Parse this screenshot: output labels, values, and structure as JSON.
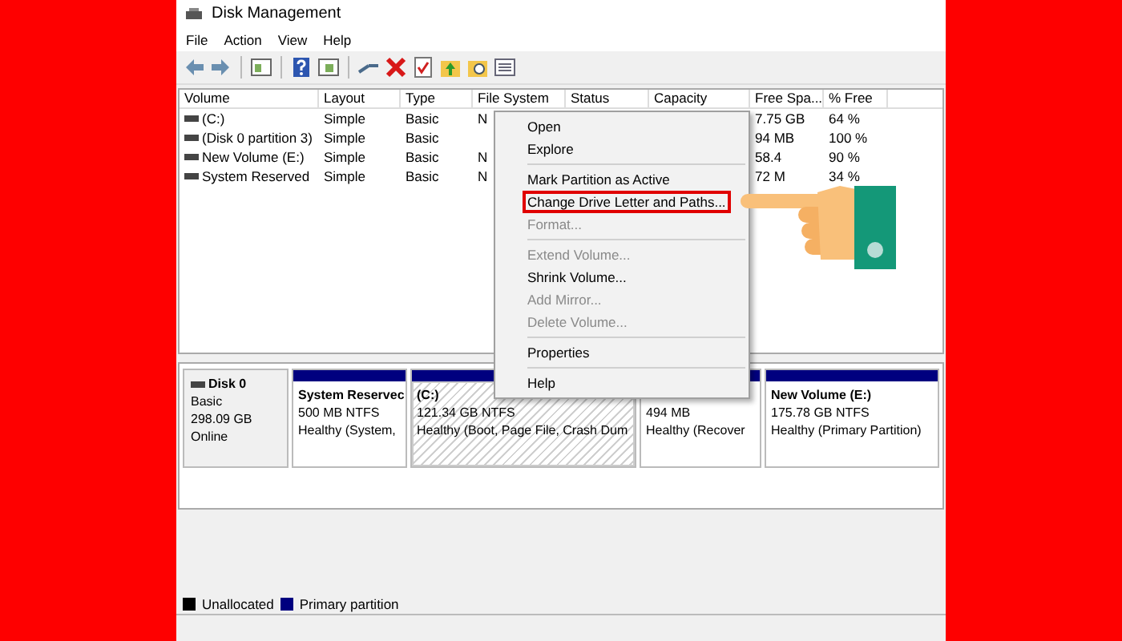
{
  "window": {
    "title": "Disk Management"
  },
  "menu_bar": [
    "File",
    "Action",
    "View",
    "Help"
  ],
  "table": {
    "columns": [
      "Volume",
      "Layout",
      "Type",
      "File System",
      "Status",
      "Capacity",
      "Free Spa...",
      "% Free"
    ],
    "rows": [
      {
        "cells": [
          "(C:)",
          "Simple",
          "Basic",
          "N",
          "",
          "",
          "7.75 GB",
          "64 %"
        ]
      },
      {
        "cells": [
          "(Disk 0 partition 3)",
          "Simple",
          "Basic",
          "",
          "",
          "",
          "94 MB",
          "100 %"
        ]
      },
      {
        "cells": [
          "New Volume (E:)",
          "Simple",
          "Basic",
          "N",
          "",
          "",
          "58.4",
          "90 %"
        ]
      },
      {
        "cells": [
          "System Reserved",
          "Simple",
          "Basic",
          "N",
          "",
          "",
          "72 M",
          "34 %"
        ]
      }
    ]
  },
  "context_menu": {
    "items": [
      {
        "kind": "item",
        "label": "Open",
        "disabled": false,
        "highlighted": false
      },
      {
        "kind": "item",
        "label": "Explore",
        "disabled": false,
        "highlighted": false
      },
      {
        "kind": "separator"
      },
      {
        "kind": "item",
        "label": "Mark Partition as Active",
        "disabled": false,
        "highlighted": false
      },
      {
        "kind": "item",
        "label": "Change Drive Letter and Paths...",
        "disabled": false,
        "highlighted": true
      },
      {
        "kind": "item",
        "label": "Format...",
        "disabled": true,
        "highlighted": false
      },
      {
        "kind": "separator"
      },
      {
        "kind": "item",
        "label": "Extend Volume...",
        "disabled": true,
        "highlighted": false
      },
      {
        "kind": "item",
        "label": "Shrink Volume...",
        "disabled": false,
        "highlighted": false
      },
      {
        "kind": "item",
        "label": "Add Mirror...",
        "disabled": true,
        "highlighted": false
      },
      {
        "kind": "item",
        "label": "Delete Volume...",
        "disabled": true,
        "highlighted": false
      },
      {
        "kind": "separator"
      },
      {
        "kind": "item",
        "label": "Properties",
        "disabled": false,
        "highlighted": false
      },
      {
        "kind": "separator"
      },
      {
        "kind": "item",
        "label": "Help",
        "disabled": false,
        "highlighted": false
      }
    ]
  },
  "disk": {
    "name": "Disk 0",
    "type": "Basic",
    "size": "298.09 GB",
    "status": "Online",
    "partitions": [
      {
        "name": "System Reservec",
        "size": "500 MB NTFS",
        "status": "Healthy (System, ",
        "selected": false
      },
      {
        "name": "(C:)",
        "size": "121.34 GB NTFS",
        "status": "Healthy (Boot, Page File, Crash Dum",
        "selected": true
      },
      {
        "size": "494 MB",
        "status": "Healthy (Recover",
        "selected": false
      },
      {
        "name": "New Volume  (E:)",
        "size": "175.78 GB NTFS",
        "status": "Healthy (Primary Partition)",
        "selected": false
      }
    ]
  },
  "legend": [
    {
      "label": "Unallocated",
      "color": "#000000"
    },
    {
      "label": "Primary partition",
      "color": "#00007f"
    }
  ]
}
